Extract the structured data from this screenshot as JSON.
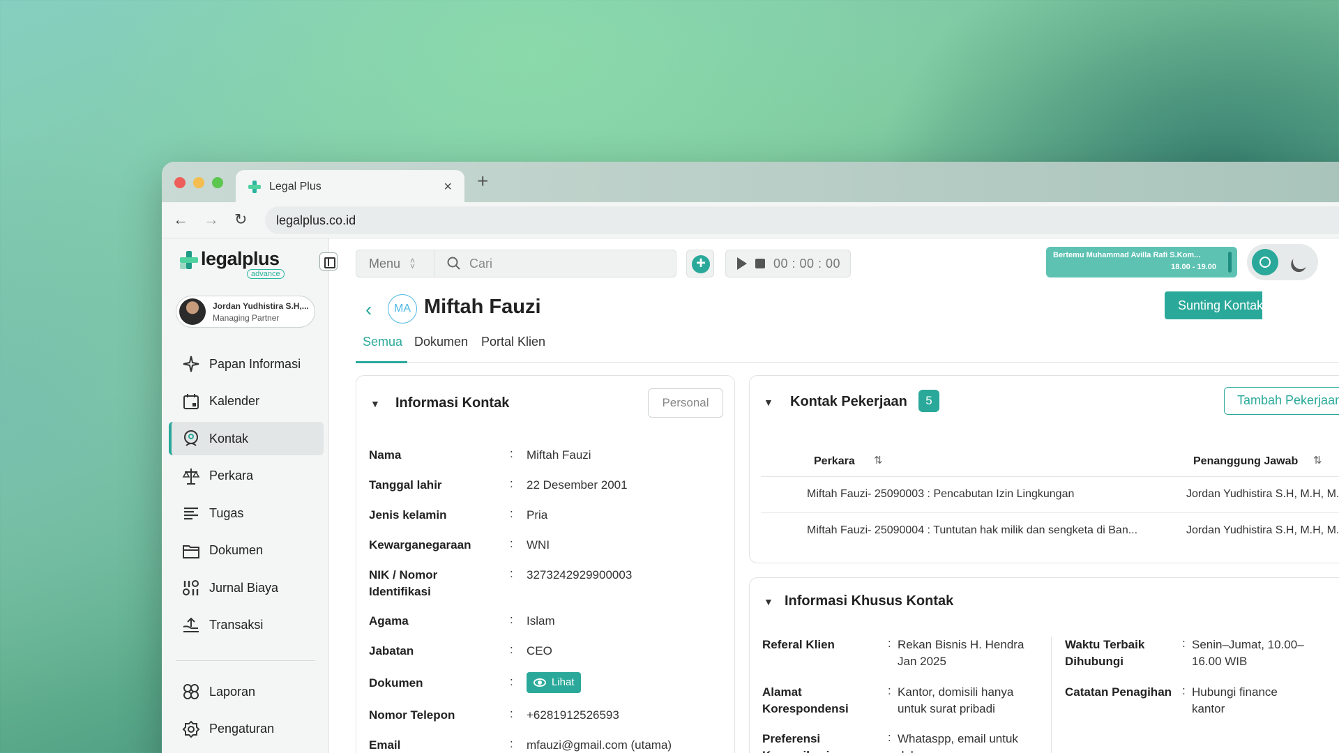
{
  "browser": {
    "tab_title": "Legal Plus",
    "tab_close": "×",
    "new_tab": "+",
    "url": "legalplus.co.id",
    "back": "←",
    "forward": "→",
    "reload": "↻"
  },
  "brand": {
    "name": "legalplus",
    "sub": "advance",
    "accent": "#2aa99a"
  },
  "user": {
    "name": "Jordan Yudhistira S.H,...",
    "role": "Managing Partner"
  },
  "sidebar": {
    "items": [
      {
        "label": "Papan Informasi",
        "icon": "dashboard-icon"
      },
      {
        "label": "Kalender",
        "icon": "calendar-icon"
      },
      {
        "label": "Kontak",
        "icon": "contact-icon",
        "active": true
      },
      {
        "label": "Perkara",
        "icon": "scale-icon"
      },
      {
        "label": "Tugas",
        "icon": "tasks-icon"
      },
      {
        "label": "Dokumen",
        "icon": "folder-icon"
      },
      {
        "label": "Jurnal Biaya",
        "icon": "journal-icon"
      },
      {
        "label": "Transaksi",
        "icon": "transaction-icon"
      }
    ],
    "bottom_items": [
      {
        "label": "Laporan",
        "icon": "report-icon"
      },
      {
        "label": "Pengaturan",
        "icon": "settings-icon"
      }
    ]
  },
  "topbar": {
    "menu_label": "Menu",
    "search_placeholder": "Cari",
    "timer": "00 : 00 : 00",
    "meeting_title": "Bertemu Muhammad Avilla Rafi S.Kom...",
    "meeting_time": "18.00 - 19.00"
  },
  "contact": {
    "initials": "MA",
    "name": "Miftah Fauzi",
    "edit_label": "Sunting Kontak",
    "tabs": [
      "Semua",
      "Dokumen",
      "Portal Klien"
    ]
  },
  "info_card": {
    "title": "Informasi Kontak",
    "type_badge": "Personal",
    "colon": ":",
    "rows": [
      {
        "label": "Nama",
        "value": "Miftah Fauzi"
      },
      {
        "label": "Tanggal lahir",
        "value": "22 Desember 2001"
      },
      {
        "label": "Jenis kelamin",
        "value": "Pria"
      },
      {
        "label": "Kewarganegaraan",
        "value": "WNI"
      },
      {
        "label": "NIK / Nomor Identifikasi",
        "value": "3273242929900003"
      },
      {
        "label": "Agama",
        "value": "Islam"
      },
      {
        "label": "Jabatan",
        "value": "CEO"
      },
      {
        "label": "Dokumen",
        "value": "Lihat"
      },
      {
        "label": "Nomor Telepon",
        "value": "+6281912526593"
      },
      {
        "label": "Email",
        "value": "mfauzi@gmail.com  (utama)"
      }
    ]
  },
  "work_card": {
    "title": "Kontak Pekerjaan",
    "count": "5",
    "add_label": "Tambah Pekerjaan",
    "columns": [
      "Perkara",
      "Penanggung Jawab"
    ],
    "rows": [
      {
        "perkara": "Miftah Fauzi- 25090003 : Pencabutan Izin Lingkungan",
        "pj": "Jordan Yudhistira S.H, M.H, M.Kn"
      },
      {
        "perkara": "Miftah Fauzi- 25090004 : Tuntutan hak milik dan sengketa di Ban...",
        "pj": "Jordan Yudhistira S.H, M.H, M.Kn"
      }
    ]
  },
  "special_card": {
    "title": "Informasi Khusus Kontak",
    "colon": ":",
    "left": [
      {
        "label": "Referal Klien",
        "value": "Rekan Bisnis H. Hendra Jan 2025"
      },
      {
        "label": "Alamat Korespondensi",
        "value": "Kantor, domisili hanya untuk surat pribadi"
      },
      {
        "label": "Preferensi Komunikasi",
        "value": "Whataspp, email untuk dokumen"
      }
    ],
    "right": [
      {
        "label": "Waktu Terbaik Dihubungi",
        "value": "Senin–Jumat, 10.00–16.00 WIB"
      },
      {
        "label": "Catatan Penagihan",
        "value": "Hubungi finance kantor"
      }
    ]
  }
}
